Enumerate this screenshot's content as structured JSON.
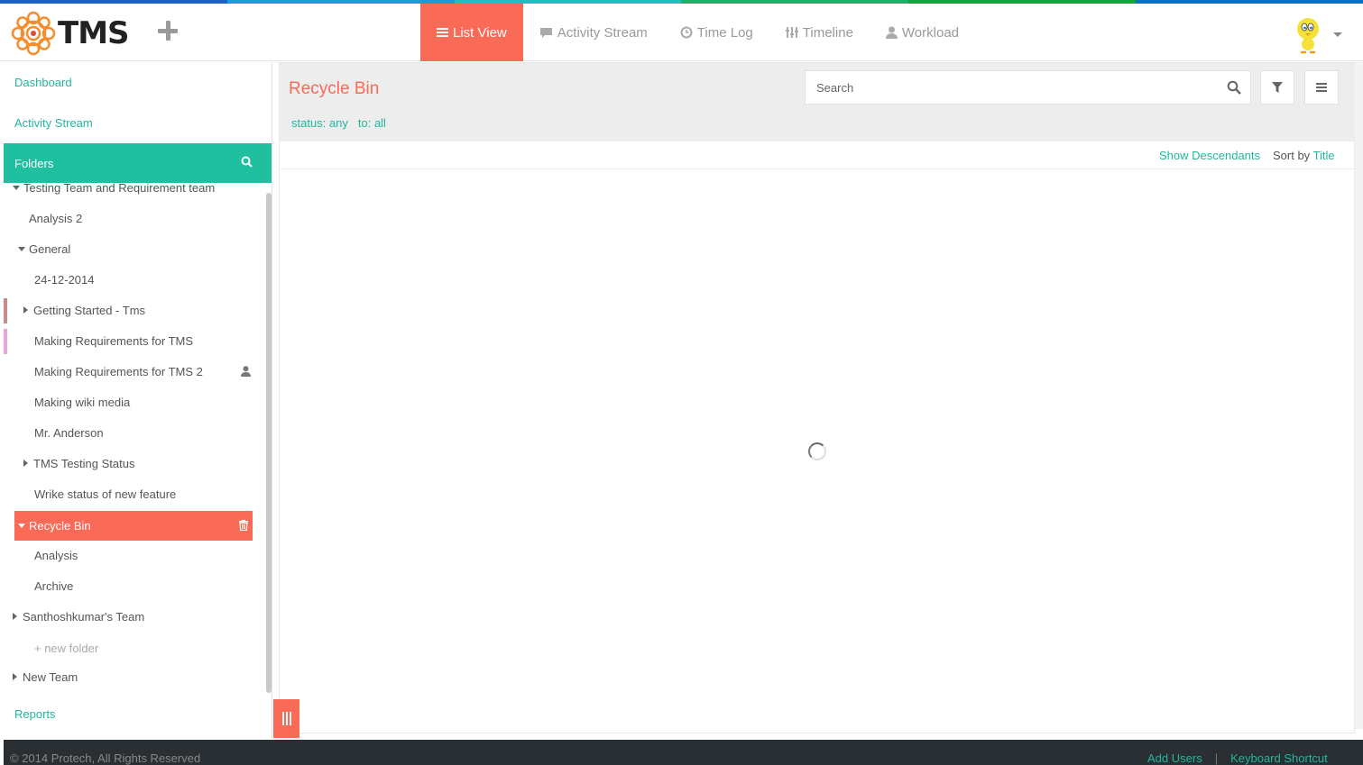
{
  "app": {
    "name": "TMS"
  },
  "colors": {
    "accent": "#f96b57",
    "teal": "#1fbf9f",
    "link": "#1fb89c",
    "footer": "#2a2f33",
    "strip": [
      "#1a63b8",
      "#1a9ad6",
      "#1fbfbf",
      "#1bb06a",
      "#18a33a",
      "#0f6fbf"
    ]
  },
  "nav": {
    "items": [
      {
        "label": "List View",
        "icon": "list-icon",
        "active": true
      },
      {
        "label": "Activity Stream",
        "icon": "comment-icon",
        "active": false
      },
      {
        "label": "Time Log",
        "icon": "clock-icon",
        "active": false
      },
      {
        "label": "Timeline",
        "icon": "timeline-icon",
        "active": false
      },
      {
        "label": "Workload",
        "icon": "user-icon",
        "active": false
      }
    ]
  },
  "sidebar": {
    "dashboard": "Dashboard",
    "activity_stream": "Activity Stream",
    "folders_label": "Folders",
    "reports": "Reports",
    "tree": [
      {
        "label": "Testing Team and Requirement team",
        "toggle": "down"
      },
      {
        "label": "Analysis 2",
        "toggle": "none"
      },
      {
        "label": "General",
        "toggle": "down"
      },
      {
        "label": "24-12-2014",
        "toggle": "none"
      },
      {
        "label": "Getting Started - Tms",
        "toggle": "right"
      },
      {
        "label": "Making Requirements for TMS",
        "toggle": "none"
      },
      {
        "label": "Making Requirements for TMS 2",
        "toggle": "none"
      },
      {
        "label": "Making wiki media",
        "toggle": "none"
      },
      {
        "label": "Mr. Anderson",
        "toggle": "none"
      },
      {
        "label": "TMS Testing Status",
        "toggle": "right"
      },
      {
        "label": "Wrike status of new feature",
        "toggle": "none"
      },
      {
        "label": "Recycle Bin",
        "toggle": "down",
        "selected": true
      },
      {
        "label": "Analysis",
        "toggle": "none"
      },
      {
        "label": "Archive",
        "toggle": "none"
      },
      {
        "label": "Santhoshkumar's Team",
        "toggle": "right"
      },
      {
        "label": "+ new folder",
        "toggle": "none"
      },
      {
        "label": "New Team",
        "toggle": "right"
      }
    ]
  },
  "main": {
    "title": "Recycle Bin",
    "search_placeholder": "Search",
    "filters": {
      "status": "status: any",
      "to": "to: all"
    },
    "show_descendants": "Show Descendants",
    "sort_prefix": "Sort by",
    "sort_value": "Title"
  },
  "footer": {
    "copyright": "© 2014 Protech, All Rights Reserved",
    "add_users": "Add Users",
    "separator": "|",
    "keyboard_shortcut": "Keyboard Shortcut"
  }
}
